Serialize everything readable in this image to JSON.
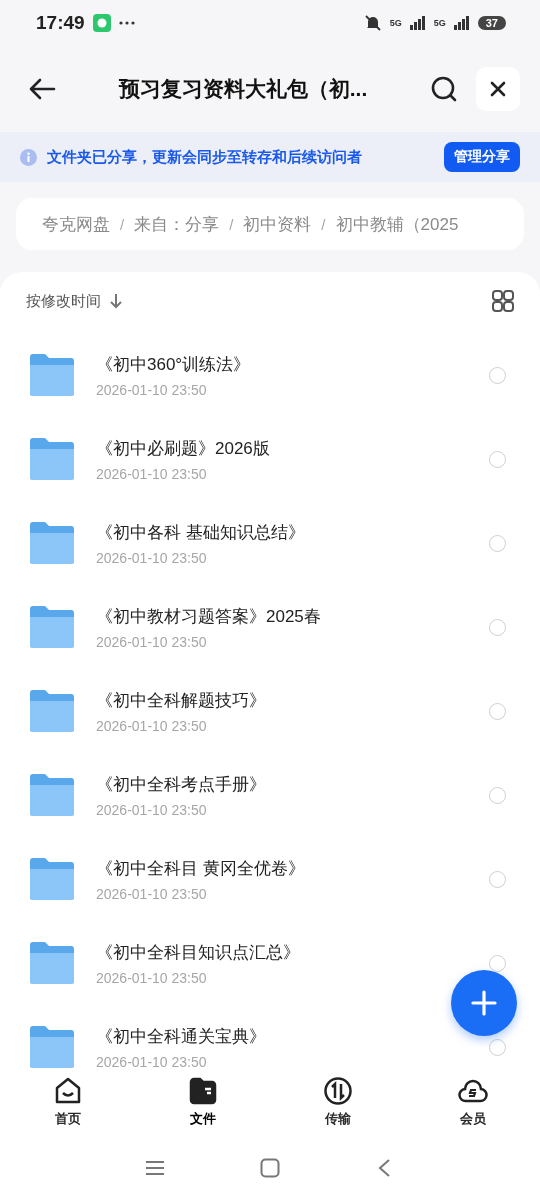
{
  "status_bar": {
    "time": "17:49",
    "signal_1": "5G",
    "signal_2": "5G",
    "battery": "37"
  },
  "header": {
    "title": "预习复习资料大礼包（初..."
  },
  "banner": {
    "text": "文件夹已分享，更新会同步至转存和后续访问者",
    "button": "管理分享"
  },
  "breadcrumb": {
    "separator": "/",
    "items": [
      "夸克网盘",
      "来自：分享",
      "初中资料",
      "初中教辅（2025"
    ]
  },
  "sort": {
    "label": "按修改时间"
  },
  "files": [
    {
      "name": "《初中360°训练法》",
      "date": "2026-01-10 23:50",
      "checked": false
    },
    {
      "name": "《初中必刷题》2026版",
      "date": "2026-01-10 23:50",
      "checked": false
    },
    {
      "name": "《初中各科 基础知识总结》",
      "date": "2026-01-10 23:50",
      "checked": false
    },
    {
      "name": "《初中教材习题答案》2025春",
      "date": "2026-01-10 23:50",
      "checked": false
    },
    {
      "name": "《初中全科解题技巧》",
      "date": "2026-01-10 23:50",
      "checked": false
    },
    {
      "name": "《初中全科考点手册》",
      "date": "2026-01-10 23:50",
      "checked": false
    },
    {
      "name": "《初中全科目 黄冈全优卷》",
      "date": "2026-01-10 23:50",
      "checked": false
    },
    {
      "name": "《初中全科目知识点汇总》",
      "date": "2026-01-10 23:50",
      "checked": false
    },
    {
      "name": "《初中全科通关宝典》",
      "date": "2026-01-10 23:50",
      "checked": false
    }
  ],
  "nav": [
    {
      "label": "首页",
      "kind": "home",
      "selected": false
    },
    {
      "label": "文件",
      "kind": "files",
      "selected": true
    },
    {
      "label": "传输",
      "kind": "transfer",
      "selected": false
    },
    {
      "label": "会员",
      "kind": "member",
      "selected": false
    }
  ]
}
